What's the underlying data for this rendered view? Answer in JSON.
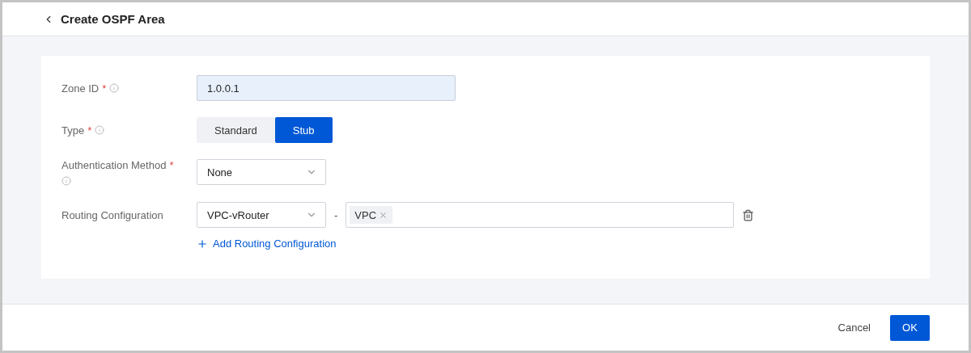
{
  "title": "Create OSPF Area",
  "fields": [
    {
      "kind": "input",
      "label": "Zone ID",
      "mark": "*",
      "info": true,
      "value": "1.0.0.1"
    },
    {
      "kind": "toggle",
      "label": "Type",
      "mark": "*",
      "info": true,
      "options": [
        {
          "label": "Standard",
          "selected": false
        },
        {
          "label": "Stub",
          "selected": true
        }
      ]
    },
    {
      "kind": "select",
      "label": "Authentication Method",
      "mark": "*",
      "info": true,
      "value": "None"
    },
    {
      "kind": "routing",
      "label": "Routing Configuration",
      "select": "VPC-vRouter",
      "separator": "-",
      "tags": [
        {
          "label": "VPC"
        }
      ],
      "add_link": "Add Routing Configuration"
    }
  ],
  "footer": {
    "cancel": "Cancel",
    "ok": "OK"
  }
}
